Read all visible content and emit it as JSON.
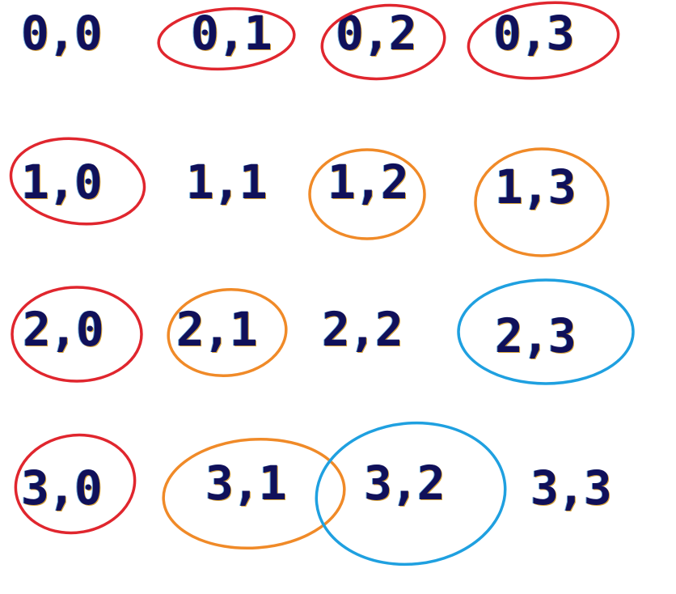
{
  "colors": {
    "text": "#10105a",
    "red": "#e0262e",
    "orange": "#f08a28",
    "blue": "#1fa0e0"
  },
  "rows": [
    [
      "0,0",
      "0,1",
      "0,2",
      "0,3"
    ],
    [
      "1,0",
      "1,1",
      "1,2",
      "1,3"
    ],
    [
      "2,0",
      "2,1",
      "2,2",
      "2,3"
    ],
    [
      "3,0",
      "3,1",
      "3,2",
      "3,3"
    ]
  ],
  "circled": {
    "red": [
      "0,1",
      "0,2",
      "0,3",
      "1,0",
      "2,0",
      "3,0"
    ],
    "orange": [
      "1,2",
      "1,3",
      "2,1",
      "3,1"
    ],
    "blue": [
      "2,3",
      "3,2"
    ]
  }
}
